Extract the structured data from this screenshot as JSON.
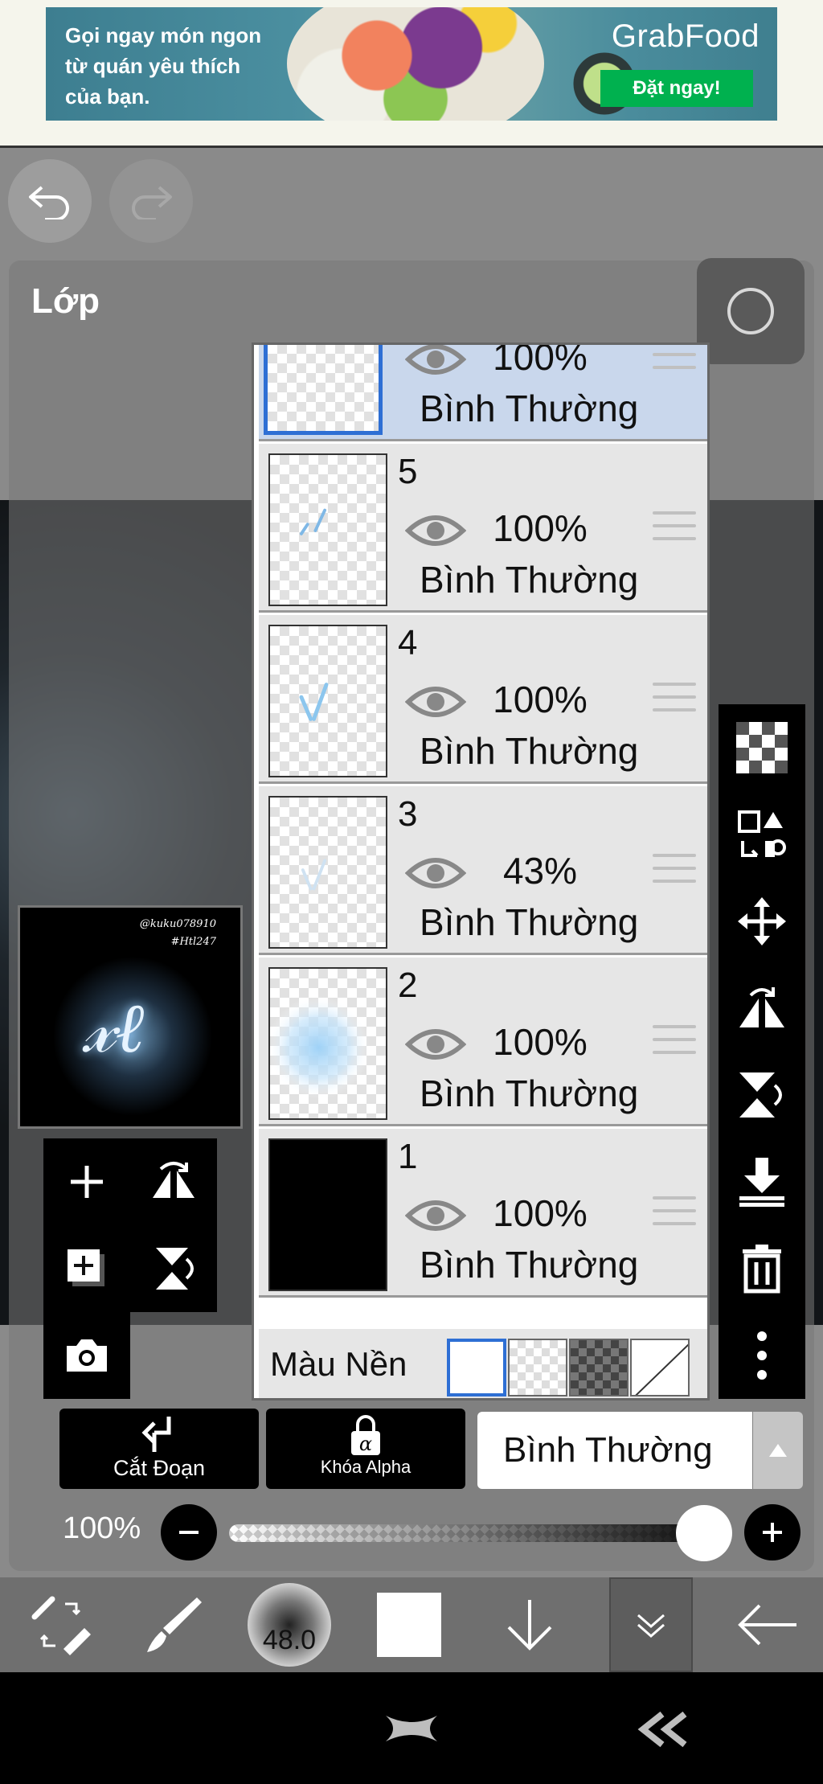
{
  "ad": {
    "text_line1": "Gọi ngay món ngon",
    "text_line2": "từ quán yêu thích",
    "text_line3": "của bạn.",
    "brand": "GrabFood",
    "cta": "Đặt ngay!"
  },
  "panel": {
    "title": "Lớp"
  },
  "layers": [
    {
      "number": "",
      "opacity": "100%",
      "blend": "Bình Thường",
      "selected": true
    },
    {
      "number": "5",
      "opacity": "100%",
      "blend": "Bình Thường",
      "selected": false
    },
    {
      "number": "4",
      "opacity": "100%",
      "blend": "Bình Thường",
      "selected": false
    },
    {
      "number": "3",
      "opacity": "43%",
      "blend": "Bình Thường",
      "selected": false
    },
    {
      "number": "2",
      "opacity": "100%",
      "blend": "Bình Thường",
      "selected": false
    },
    {
      "number": "1",
      "opacity": "100%",
      "blend": "Bình Thường",
      "selected": false
    }
  ],
  "background": {
    "label": "Màu Nền"
  },
  "preview": {
    "credit_line1": "@kuku078910",
    "credit_line2": "#Htl247"
  },
  "controls": {
    "clipping_label": "Cắt Đoạn",
    "alpha_lock_label": "Khóa Alpha",
    "blend_mode": "Bình Thường",
    "opacity_label": "100%",
    "opacity_value": 1.0
  },
  "toolbar": {
    "brush_size": "48.0"
  },
  "colors": {
    "accent": "#2e6fd4",
    "selected_row": "#c9d7ec",
    "ad_cta": "#00b14f"
  }
}
